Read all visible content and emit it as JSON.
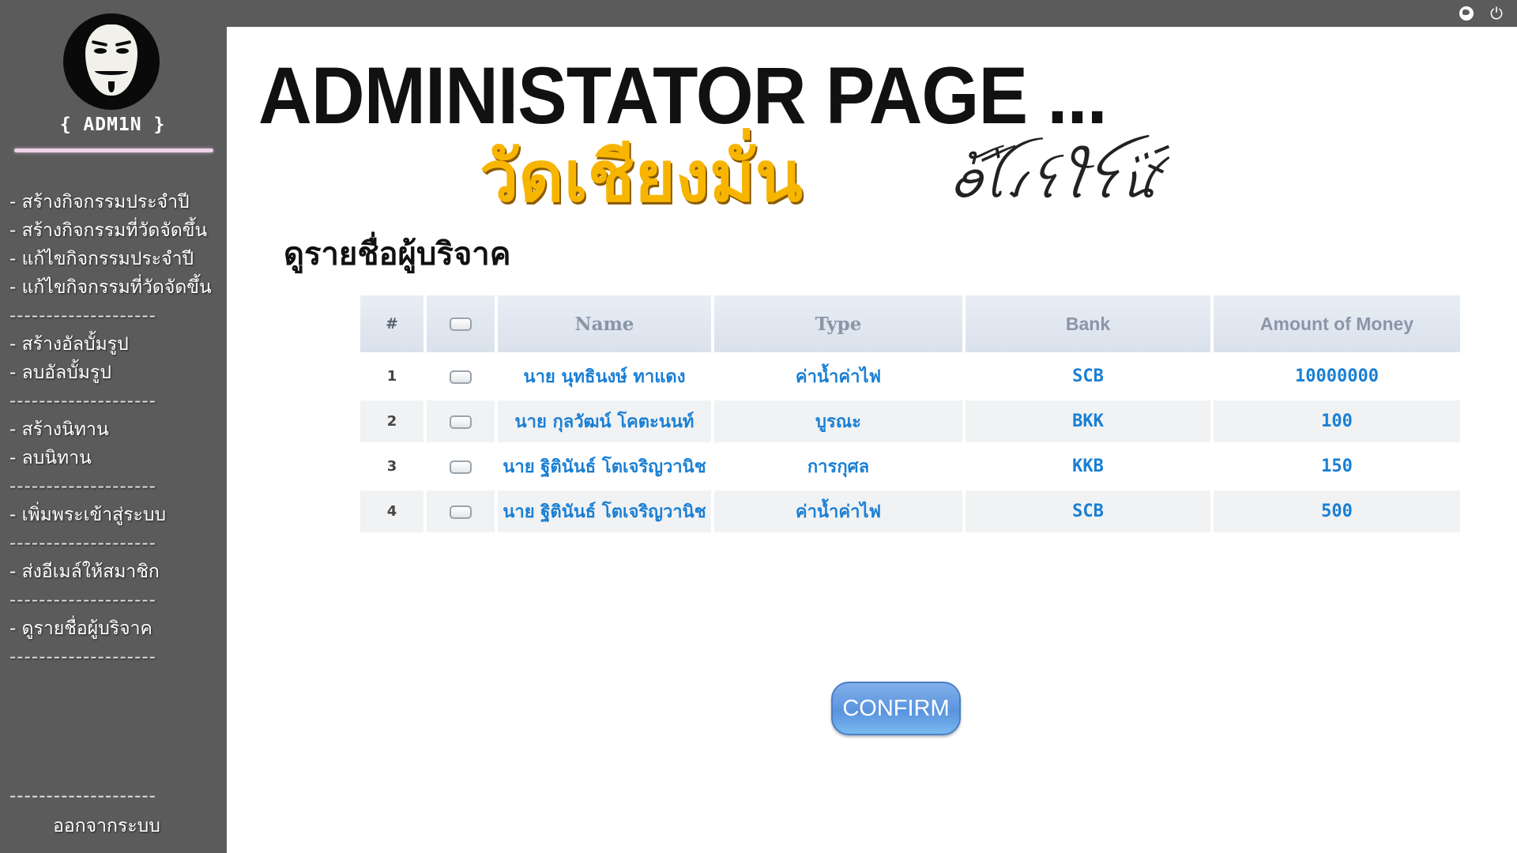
{
  "topbar": {
    "icons": [
      "globe-icon",
      "power-icon"
    ]
  },
  "sidebar": {
    "admin_tag": "{ ADM1N }",
    "menu": [
      {
        "type": "item",
        "label": "- สร้างกิจกรรมประจำปี"
      },
      {
        "type": "item",
        "label": "- สร้างกิจกรรมที่วัดจัดขึ้น"
      },
      {
        "type": "item",
        "label": "- แก้ไขกิจกรรมประจำปี"
      },
      {
        "type": "item",
        "label": "- แก้ไขกิจกรรมที่วัดจัดขึ้น"
      },
      {
        "type": "sep",
        "label": "--------------------"
      },
      {
        "type": "item",
        "label": "- สร้างอัลบั้มรูป"
      },
      {
        "type": "item",
        "label": "- ลบอัลบั้มรูป"
      },
      {
        "type": "sep",
        "label": "--------------------"
      },
      {
        "type": "item",
        "label": "- สร้างนิทาน"
      },
      {
        "type": "item",
        "label": "- ลบนิทาน"
      },
      {
        "type": "sep",
        "label": "--------------------"
      },
      {
        "type": "item",
        "label": "- เพิ่มพระเข้าสู่ระบบ"
      },
      {
        "type": "sep",
        "label": "--------------------"
      },
      {
        "type": "item",
        "label": "- ส่งอีเมล์ให้สมาชิก"
      },
      {
        "type": "sep",
        "label": "--------------------"
      },
      {
        "type": "item",
        "label": "- ดูรายชื่อผู้บริจาค"
      },
      {
        "type": "sep",
        "label": "--------------------"
      }
    ],
    "logout_separator": "--------------------",
    "logout": "ออกจากระบบ"
  },
  "main": {
    "title": "ADMINISTATOR PAGE ...",
    "temple_name": "วัดเชียงมั่น",
    "section_title": "ดูรายชื่อผู้บริจาค",
    "confirm_label": "CONFIRM"
  },
  "table": {
    "headers": {
      "num": "#",
      "name": "Name",
      "type": "Type",
      "bank": "Bank",
      "amount": "Amount of Money"
    },
    "rows": [
      {
        "num": "1",
        "name": "นาย นุทธินงษ์ ทาแดง",
        "type": "ค่าน้ำค่าไฟ",
        "bank": "SCB",
        "amount": "10000000"
      },
      {
        "num": "2",
        "name": "นาย กุลวัฒน์ โคตะนนท์",
        "type": "บูรณะ",
        "bank": "BKK",
        "amount": "100"
      },
      {
        "num": "3",
        "name": "นาย ฐิตินันธ์ โตเจริญวานิช",
        "type": "การกุศล",
        "bank": "KKB",
        "amount": "150"
      },
      {
        "num": "4",
        "name": "นาย ฐิตินันธ์ โตเจริญวานิช",
        "type": "ค่าน้ำค่าไฟ",
        "bank": "SCB",
        "amount": "500"
      }
    ]
  },
  "colors": {
    "sidebar_bg": "#5b5b5b",
    "temple_name": "#f7b500",
    "table_text": "#1a7fd4",
    "confirm_button": "#5a93de"
  }
}
